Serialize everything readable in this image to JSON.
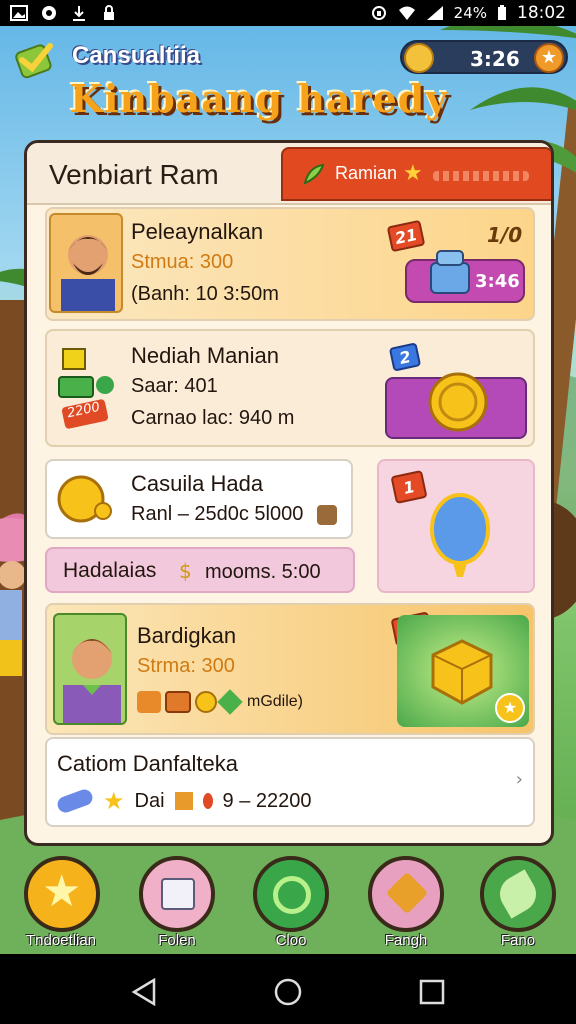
{
  "status_bar": {
    "battery": "24%",
    "time": "18:02",
    "icons": [
      "gallery-icon",
      "app-icon",
      "download-icon",
      "lock-icon",
      "vpn-icon",
      "wifi-icon",
      "signal-icon",
      "battery-icon"
    ]
  },
  "header": {
    "subtitle": "Cansualtiia",
    "title": "Kinbaang haredy",
    "timer": "3:26"
  },
  "panel": {
    "title": "Venbiart Ram",
    "tab_label": "Ramian"
  },
  "cards": [
    {
      "title": "Peleaynalkan",
      "stat": "Stmua: 300",
      "line": "(Banh: 10 3:50m",
      "badge": "21",
      "counter": "1/0",
      "button": "3:46"
    },
    {
      "title": "Nediah Manian",
      "stat": "Saar: 401",
      "line": "Carnao lac: 940 m",
      "badge": "2",
      "chip": "2200"
    },
    {
      "title": "Casuila Hada",
      "line": "Ranl – 25d0c 5l000",
      "badge": "1"
    },
    {
      "title": "Hadalaias",
      "line": "mooms. 5:00"
    },
    {
      "title": "Bardigkan",
      "stat": "Strma: 300",
      "line": "mGdile)",
      "badge": "E2"
    },
    {
      "title": "Catiom Danfalteka",
      "line": "Dai",
      "value": "9 – 22200"
    }
  ],
  "nav": [
    {
      "label": "Tndoetlian",
      "icon": "star-icon",
      "color": "#f6b21a"
    },
    {
      "label": "Folen",
      "icon": "box-icon",
      "color": "#f0b0c8"
    },
    {
      "label": "Cloo",
      "icon": "target-icon",
      "color": "#3aa64a"
    },
    {
      "label": "Fangh",
      "icon": "tools-icon",
      "color": "#e8a0c0"
    },
    {
      "label": "Fano",
      "icon": "leaf-icon",
      "color": "#4aa84a"
    }
  ],
  "colors": {
    "accent": "#f7a21b",
    "tab": "#e14a20",
    "panel": "#fdf4e3"
  }
}
